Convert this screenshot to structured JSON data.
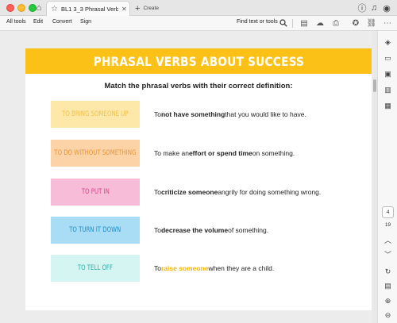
{
  "titlebar": {
    "tab_title": "BL1 3_3 Phrasal Verbs...",
    "new_tab_label": "Create"
  },
  "toolbar": {
    "menu": [
      "All tools",
      "Edit",
      "Convert",
      "Sign"
    ],
    "find_label": "Find text or tools"
  },
  "document": {
    "banner_title": "PHRASAL VERBS ABOUT SUCCESS",
    "instruction": "Match the phrasal verbs with their correct definition:",
    "rows": [
      {
        "verb": "TO BRING SOMEONE UP",
        "def_pre": "To ",
        "def_strong": "not have something",
        "def_mid": " that you would like to have.",
        "def_strong2": "",
        "def_post": "",
        "bg": "#fde8a9",
        "fg": "#f2c24a"
      },
      {
        "verb": "TO DO WITHOUT SOMETHING",
        "def_pre": "To make an ",
        "def_strong": "effort or spend time",
        "def_mid": " on something.",
        "def_strong2": "",
        "def_post": "",
        "bg": "#fbd3a6",
        "fg": "#e8963a"
      },
      {
        "verb": "TO PUT IN",
        "def_pre": "To ",
        "def_strong": "criticize someone",
        "def_mid": " angrily for doing something wrong.",
        "def_strong2": "",
        "def_post": "",
        "bg": "#f6bcd8",
        "fg": "#e2418c"
      },
      {
        "verb": "TO TURN IT DOWN",
        "def_pre": "To ",
        "def_strong": "decrease the volume",
        "def_mid": " of something.",
        "def_strong2": "",
        "def_post": "",
        "bg": "#a9ddf6",
        "fg": "#1a8fd0"
      },
      {
        "verb": "TO TELL OFF",
        "def_pre": "To ",
        "def_strong": "",
        "def_mid": "",
        "def_strong2": "raise someone",
        "def_post": " when they are a child.",
        "bg": "#d5f5f3",
        "fg": "#22b1a8"
      }
    ]
  },
  "sidebar": {
    "current_page": "4",
    "total_pages": "19"
  },
  "icons": {
    "home": "home-icon",
    "help": "help-icon",
    "notifications": "bell-icon",
    "account": "account-icon",
    "search": "search-icon",
    "print": "print-icon",
    "link": "link-icon",
    "more": "more-icon"
  }
}
